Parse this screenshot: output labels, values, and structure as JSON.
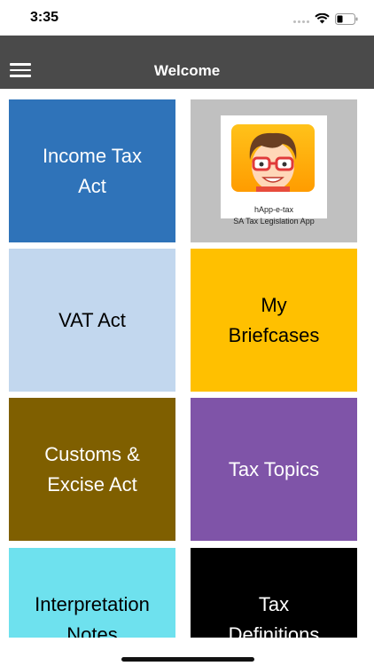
{
  "status": {
    "time": "3:35"
  },
  "nav": {
    "title": "Welcome"
  },
  "logo": {
    "name": "hApp-e-tax",
    "tagline": "SA Tax Legislation App"
  },
  "tiles": [
    {
      "label": "Income Tax\nAct",
      "bg": "#2f73b9",
      "color": "#ffffff"
    },
    {
      "label": "VAT Act",
      "bg": "#c2d7ee",
      "color": "#000000"
    },
    {
      "label": "My\nBriefcases",
      "bg": "#ffc000",
      "color": "#000000"
    },
    {
      "label": "Customs &\nExcise Act",
      "bg": "#7f5f00",
      "color": "#ffffff"
    },
    {
      "label": "Tax Topics",
      "bg": "#7f54a8",
      "color": "#ffffff"
    },
    {
      "label": "Interpretation\nNotes",
      "bg": "#6ee1ee",
      "color": "#000000"
    },
    {
      "label": "Tax\nDefinitions",
      "bg": "#000000",
      "color": "#ffffff"
    }
  ],
  "logo_tile_bg": "#c0c0c0"
}
